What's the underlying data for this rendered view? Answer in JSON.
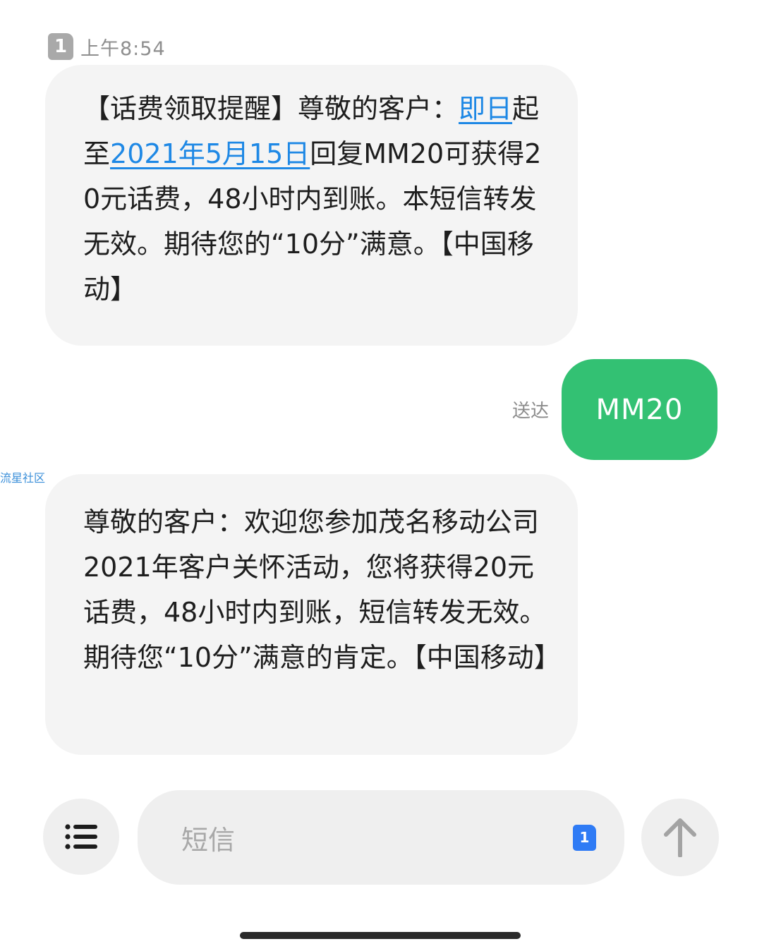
{
  "header": {
    "sim_label": "1",
    "time": "上午8:54"
  },
  "messages": {
    "incoming_1": {
      "part1": "【话费领取提醒】尊敬的客户：",
      "link1": "即日",
      "part2": "起至",
      "link2": "2021年5月15日",
      "part3": "回复MM20可获得20元话费，48小时内到账。本短信转发无效。期待您的“10分”满意。【中国移动】"
    },
    "outgoing_1": {
      "status": "送达",
      "text": "MM20"
    },
    "incoming_2": {
      "text": "尊敬的客户：欢迎您参加茂名移动公司2021年客户关怀活动，您将获得20元话费，48小时内到账，短信转发无效。期待您“10分”满意的肯定。【中国移动】"
    }
  },
  "watermark": "流星社区",
  "composer": {
    "placeholder": "短信",
    "sim_label": "1"
  },
  "colors": {
    "link": "#1e88e5",
    "outgoing_bubble": "#33c173",
    "incoming_bubble": "#f4f4f4",
    "sim_active": "#2f7bf5"
  },
  "icons": {
    "menu": "list-icon",
    "send": "arrow-up-icon",
    "sim": "sim-card-icon"
  }
}
